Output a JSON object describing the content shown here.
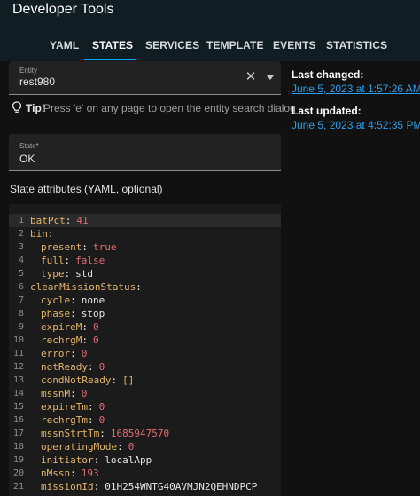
{
  "app": {
    "title": "Developer Tools"
  },
  "tabs": [
    {
      "label": "YAML",
      "active": false
    },
    {
      "label": "STATES",
      "active": true
    },
    {
      "label": "SERVICES",
      "active": false
    },
    {
      "label": "TEMPLATE",
      "active": false
    },
    {
      "label": "EVENTS",
      "active": false
    },
    {
      "label": "STATISTICS",
      "active": false
    }
  ],
  "entity": {
    "label": "Entity",
    "value": "rest980"
  },
  "tip": {
    "bold": "Tip!",
    "text": "Press 'e' on any page to open the entity search dialog"
  },
  "state": {
    "label": "State*",
    "value": "OK"
  },
  "attributes": {
    "label": "State attributes (YAML, optional)",
    "lines": [
      {
        "num": "1",
        "key": "batPct",
        "value": "41",
        "value_type": "number"
      },
      {
        "num": "2",
        "key": "bin",
        "value": "",
        "value_type": "none"
      },
      {
        "num": "3",
        "key": "present",
        "value": "true",
        "value_type": "bool"
      },
      {
        "num": "4",
        "key": "full",
        "value": "false",
        "value_type": "bool"
      },
      {
        "num": "5",
        "key": "type",
        "value": "std",
        "value_type": "string"
      },
      {
        "num": "6",
        "key": "cleanMissionStatus",
        "value": "",
        "value_type": "none"
      },
      {
        "num": "7",
        "key": "cycle",
        "value": "none",
        "value_type": "string"
      },
      {
        "num": "8",
        "key": "phase",
        "value": "stop",
        "value_type": "string"
      },
      {
        "num": "9",
        "key": "expireM",
        "value": "0",
        "value_type": "number"
      },
      {
        "num": "10",
        "key": "rechrgM",
        "value": "0",
        "value_type": "number"
      },
      {
        "num": "11",
        "key": "error",
        "value": "0",
        "value_type": "number"
      },
      {
        "num": "12",
        "key": "notReady",
        "value": "0",
        "value_type": "number"
      },
      {
        "num": "13",
        "key": "condNotReady",
        "value": "[]",
        "value_type": "array"
      },
      {
        "num": "14",
        "key": "mssnM",
        "value": "0",
        "value_type": "number"
      },
      {
        "num": "15",
        "key": "expireTm",
        "value": "0",
        "value_type": "number"
      },
      {
        "num": "16",
        "key": "rechrgTm",
        "value": "0",
        "value_type": "number"
      },
      {
        "num": "17",
        "key": "mssnStrtTm",
        "value": "1685947570",
        "value_type": "number"
      },
      {
        "num": "18",
        "key": "operatingMode",
        "value": "0",
        "value_type": "number"
      },
      {
        "num": "19",
        "key": "initiator",
        "value": "localApp",
        "value_type": "string"
      },
      {
        "num": "20",
        "key": "nMssn",
        "value": "193",
        "value_type": "number"
      },
      {
        "num": "21",
        "key": "missionId",
        "value": "01H254WNTG40AVMJN2QEHNDPCP",
        "value_type": "string"
      }
    ]
  },
  "meta": {
    "last_changed_label": "Last changed:",
    "last_changed_value": "June 5, 2023 at 1:57:26 AM",
    "last_updated_label": "Last updated:",
    "last_updated_value": "June 5, 2023 at 4:52:35 PM"
  },
  "colors": {
    "accent": "#03a9f4",
    "link": "#2aa0ef",
    "header": "#101e24"
  },
  "icons": {
    "clear": "close-icon",
    "dropdown": "menu-down-icon",
    "tip": "lightbulb-icon"
  }
}
